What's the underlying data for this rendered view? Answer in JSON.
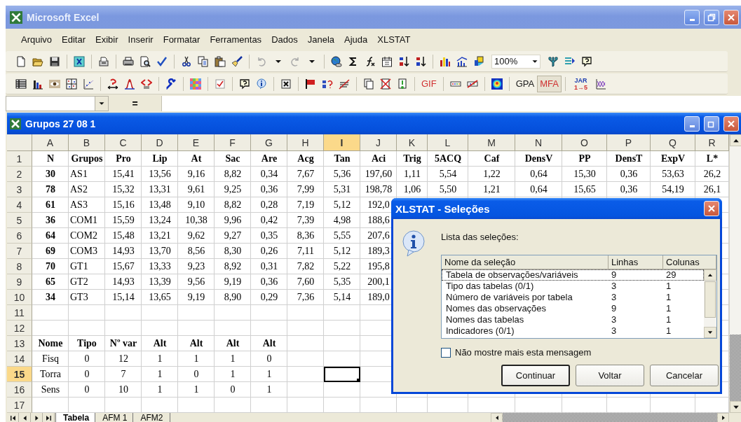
{
  "window": {
    "title": "Microsoft Excel"
  },
  "menu": [
    "Arquivo",
    "Editar",
    "Exibir",
    "Inserir",
    "Formatar",
    "Ferramentas",
    "Dados",
    "Janela",
    "Ajuda",
    "XLSTAT"
  ],
  "toolbar_1": {
    "zoom": "100%"
  },
  "toolbar_2_text": [
    {
      "label": "GIF",
      "color": "#d03030",
      "selected": false
    },
    {
      "label": "GPA",
      "color": "#202020",
      "selected": false
    },
    {
      "label": "MFA",
      "color": "#d03030",
      "selected": true
    },
    {
      "label": "JAR",
      "sublabel": "1→5",
      "color": "#2040b0",
      "selected": false
    }
  ],
  "formula_bar": {
    "equals": "="
  },
  "workbook": {
    "title": "Grupos 27 08 1"
  },
  "sheet": {
    "columns": [
      {
        "label": "A",
        "selected": false
      },
      {
        "label": "B",
        "selected": false
      },
      {
        "label": "C",
        "selected": false
      },
      {
        "label": "D",
        "selected": false
      },
      {
        "label": "E",
        "selected": false
      },
      {
        "label": "F",
        "selected": false
      },
      {
        "label": "G",
        "selected": false
      },
      {
        "label": "H",
        "selected": false
      },
      {
        "label": "I",
        "selected": true
      },
      {
        "label": "J",
        "selected": false
      },
      {
        "label": "K",
        "selected": false
      },
      {
        "label": "L",
        "selected": false
      },
      {
        "label": "M",
        "selected": false
      },
      {
        "label": "N",
        "selected": false
      },
      {
        "label": "O",
        "selected": false
      },
      {
        "label": "P",
        "selected": false
      },
      {
        "label": "Q",
        "selected": false
      },
      {
        "label": "R",
        "selected": false
      }
    ],
    "rows": [
      {
        "number": "1",
        "kind": "header",
        "selected": false,
        "cells": [
          "N",
          "Grupos",
          "Pro",
          "Lip",
          "At",
          "Sac",
          "Are",
          "Acg",
          "Tan",
          "Aci",
          "Trig",
          "5ACQ",
          "Caf",
          "DensV",
          "PP",
          "DensT",
          "ExpV",
          "L*"
        ]
      },
      {
        "number": "2",
        "kind": "record",
        "selected": false,
        "cells": [
          "30",
          "AS1",
          "15,41",
          "13,56",
          "9,16",
          "8,82",
          "0,34",
          "7,67",
          "5,36",
          "197,60",
          "1,11",
          "5,54",
          "1,22",
          "0,64",
          "15,30",
          "0,36",
          "53,63",
          "26,2"
        ]
      },
      {
        "number": "3",
        "kind": "record",
        "selected": false,
        "cells": [
          "78",
          "AS2",
          "15,32",
          "13,31",
          "9,61",
          "9,25",
          "0,36",
          "7,99",
          "5,31",
          "198,78",
          "1,06",
          "5,50",
          "1,21",
          "0,64",
          "15,65",
          "0,36",
          "54,19",
          "26,1"
        ]
      },
      {
        "number": "4",
        "kind": "record",
        "selected": false,
        "cells": [
          "61",
          "AS3",
          "15,16",
          "13,48",
          "9,10",
          "8,82",
          "0,28",
          "7,19",
          "5,12",
          "192,0"
        ]
      },
      {
        "number": "5",
        "kind": "record",
        "selected": false,
        "cells": [
          "36",
          "COM1",
          "15,59",
          "13,24",
          "10,38",
          "9,96",
          "0,42",
          "7,39",
          "4,98",
          "188,6"
        ]
      },
      {
        "number": "6",
        "kind": "record",
        "selected": false,
        "cells": [
          "64",
          "COM2",
          "15,48",
          "13,21",
          "9,62",
          "9,27",
          "0,35",
          "8,36",
          "5,55",
          "207,6"
        ]
      },
      {
        "number": "7",
        "kind": "record",
        "selected": false,
        "cells": [
          "69",
          "COM3",
          "14,93",
          "13,70",
          "8,56",
          "8,30",
          "0,26",
          "7,11",
          "5,12",
          "189,3"
        ]
      },
      {
        "number": "8",
        "kind": "record",
        "selected": false,
        "cells": [
          "70",
          "GT1",
          "15,67",
          "13,33",
          "9,23",
          "8,92",
          "0,31",
          "7,82",
          "5,22",
          "195,8"
        ]
      },
      {
        "number": "9",
        "kind": "record",
        "selected": false,
        "cells": [
          "65",
          "GT2",
          "14,93",
          "13,39",
          "9,56",
          "9,19",
          "0,36",
          "7,60",
          "5,35",
          "200,1"
        ]
      },
      {
        "number": "10",
        "kind": "record",
        "selected": false,
        "cells": [
          "34",
          "GT3",
          "15,14",
          "13,65",
          "9,19",
          "8,90",
          "0,29",
          "7,36",
          "5,14",
          "189,0"
        ]
      },
      {
        "number": "11",
        "kind": "plain",
        "selected": false
      },
      {
        "number": "12",
        "kind": "plain",
        "selected": false
      },
      {
        "number": "13",
        "kind": "header",
        "selected": false,
        "cells": [
          "Nome",
          "Tipo",
          "Nº var",
          "Alt",
          "Alt",
          "Alt",
          "Alt"
        ]
      },
      {
        "number": "14",
        "kind": "plain",
        "selected": false,
        "cells": [
          "Fisq",
          "0",
          "12",
          "1",
          "1",
          "1",
          "0"
        ]
      },
      {
        "number": "15",
        "kind": "plain",
        "selected": true,
        "cells": [
          "Torra",
          "0",
          "7",
          "1",
          "0",
          "1",
          "1"
        ]
      },
      {
        "number": "16",
        "kind": "plain",
        "selected": false,
        "cells": [
          "Sens",
          "0",
          "10",
          "1",
          "1",
          "0",
          "1"
        ]
      },
      {
        "number": "17",
        "kind": "plain",
        "selected": false
      }
    ]
  },
  "sheet_tabs": [
    {
      "label": "Tabela",
      "selected": true
    },
    {
      "label": "AFM 1",
      "selected": false
    },
    {
      "label": "AFM2",
      "selected": false
    }
  ],
  "dialog": {
    "title": "XLSTAT - Seleções",
    "prompt": "Lista das seleções:",
    "columns": [
      "Nome da seleção",
      "Linhas",
      "Colunas"
    ],
    "rows": [
      {
        "name": "Tabela de observações/variáveis",
        "rows": "9",
        "columns": "29",
        "selected": true
      },
      {
        "name": "Tipo das tabelas (0/1)",
        "rows": "3",
        "columns": "1",
        "selected": false
      },
      {
        "name": "Número de variáveis por tabela",
        "rows": "3",
        "columns": "1",
        "selected": false
      },
      {
        "name": "Nomes das observações",
        "rows": "9",
        "columns": "1",
        "selected": false
      },
      {
        "name": "Nomes das tabelas",
        "rows": "3",
        "columns": "1",
        "selected": false
      },
      {
        "name": "Indicadores (0/1)",
        "rows": "3",
        "columns": "1",
        "selected": false
      }
    ],
    "checkbox": {
      "label": "Não mostre mais esta mensagem",
      "checked": false
    },
    "buttons": [
      {
        "label": "Continuar",
        "default": true
      },
      {
        "label": "Voltar",
        "default": false
      },
      {
        "label": "Cancelar",
        "default": false
      }
    ]
  }
}
